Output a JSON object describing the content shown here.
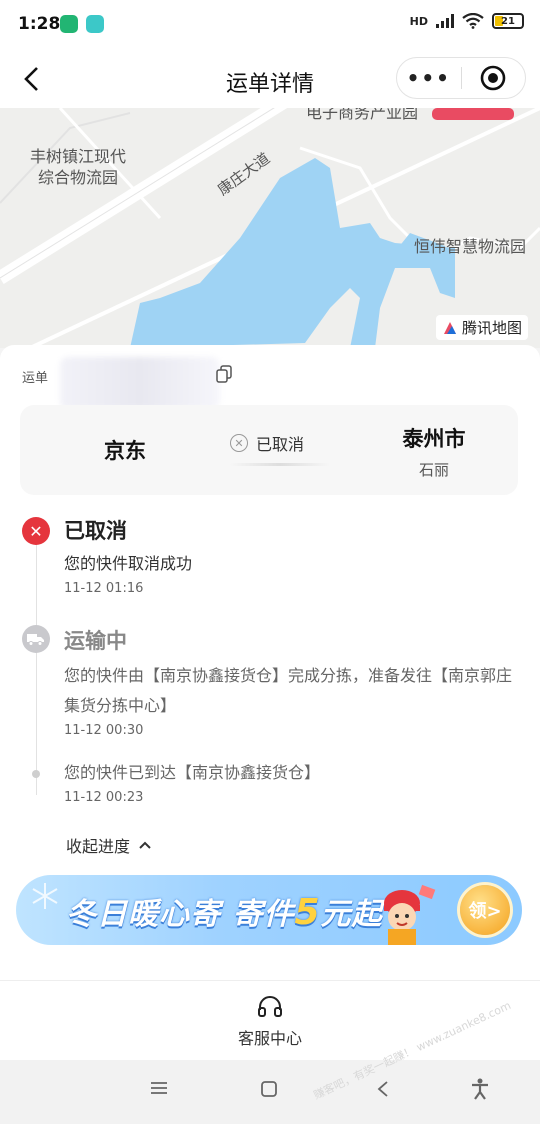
{
  "status": {
    "time": "1:28",
    "battery": "21",
    "network": "HD"
  },
  "nav": {
    "title": "运单详情",
    "more": "•••"
  },
  "map": {
    "labels": [
      "丰树镇江现代\n综合物流园",
      "康庄大道",
      "恒伟智慧物流园",
      "电子商务产业园"
    ],
    "logo": "腾讯地图",
    "colors": {
      "water": "#9fd3f4",
      "road": "#ffffff",
      "land": "#efefed"
    }
  },
  "waybill": {
    "prefix": "运单"
  },
  "route": {
    "from": "京东",
    "status": "已取消",
    "to_city": "泰州市",
    "to_name": "石丽"
  },
  "timeline": [
    {
      "title": "已取消",
      "desc": "您的快件取消成功",
      "time": "11-12 01:16"
    },
    {
      "title": "运输中",
      "desc": "您的快件由【南京协鑫接货仓】完成分拣，准备发往【南京郭庄集货分拣中心】",
      "time": "11-12 00:30"
    },
    {
      "title": "",
      "desc": "您的快件已到达【南京协鑫接货仓】",
      "time": "11-12 00:23"
    }
  ],
  "collapse_label": "收起进度",
  "banner": {
    "text_a": "冬日暖心寄 寄件",
    "highlight": "5",
    "text_b": "元起",
    "button": "领>"
  },
  "service": {
    "label": "客服中心"
  },
  "watermark": "赚客吧，有奖一起赚！ www.zuanke8.com",
  "accent": "#e5353d"
}
